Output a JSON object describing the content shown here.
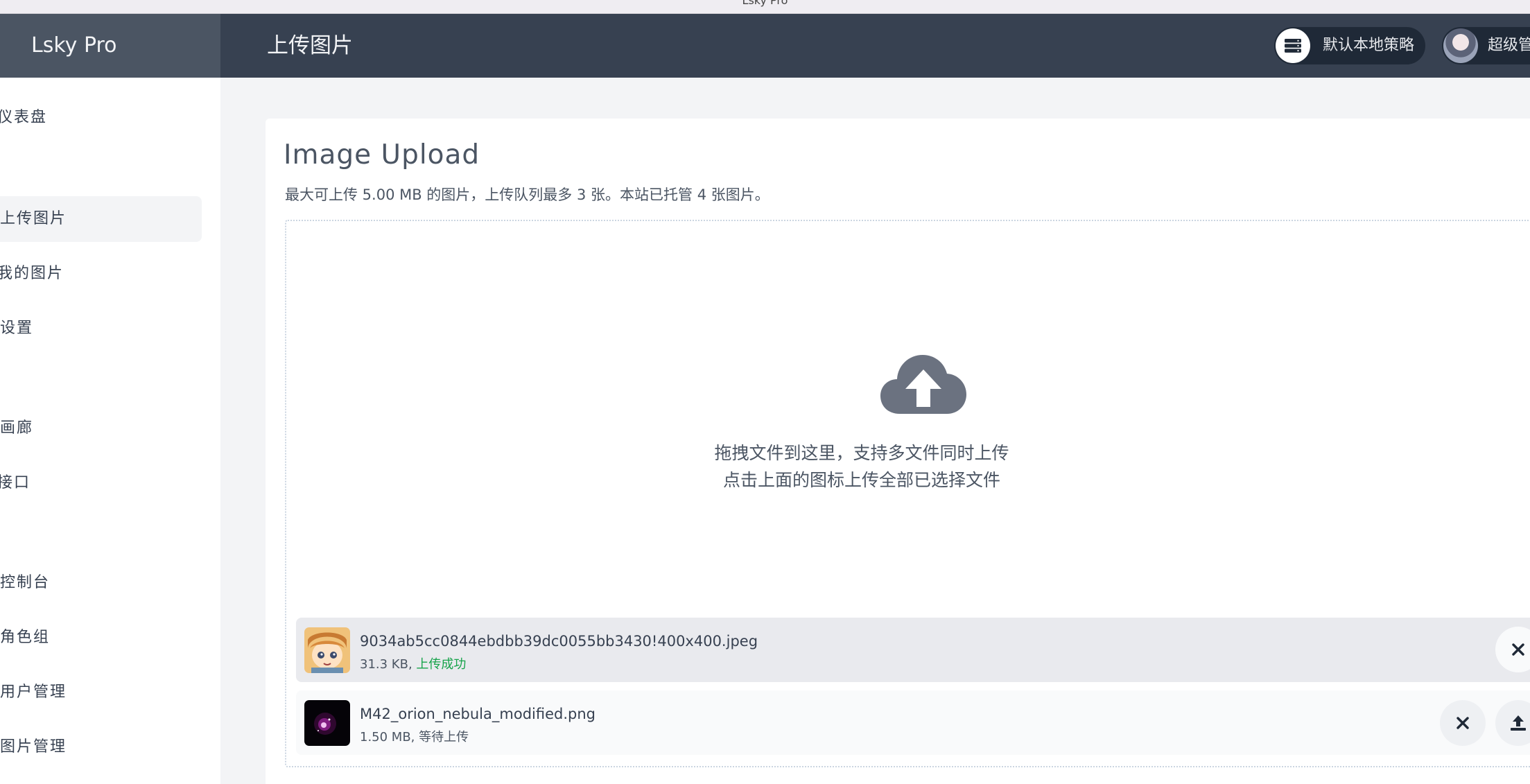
{
  "window": {
    "title": "Lsky Pro"
  },
  "brand": {
    "name": "Lsky Pro"
  },
  "header": {
    "page_title": "上传图片",
    "strategy_label": "默认本地策略",
    "user_label": "超级管"
  },
  "sidebar": {
    "items": [
      {
        "label": "仪表盘"
      },
      {
        "label": "上传图片",
        "active": true
      },
      {
        "label": "我的图片"
      },
      {
        "label": "设置"
      },
      {
        "label": "画廊"
      },
      {
        "label": "接口"
      },
      {
        "label": "控制台"
      },
      {
        "label": "角色组"
      },
      {
        "label": "用户管理"
      },
      {
        "label": "图片管理"
      }
    ]
  },
  "upload": {
    "title": "Image Upload",
    "subtitle": "最大可上传 5.00 MB 的图片，上传队列最多 3 张。本站已托管 4 张图片。",
    "drop_hint_line1": "拖拽文件到这里，支持多文件同时上传",
    "drop_hint_line2": "点击上面的图标上传全部已选择文件",
    "files": [
      {
        "name": "9034ab5cc0844ebdbb39dc0055bb3430!400x400.jpeg",
        "size": "31.3 KB, ",
        "status": "上传成功"
      },
      {
        "name": "M42_orion_nebula_modified.png",
        "size": "1.50 MB, ",
        "status": "等待上传"
      }
    ]
  },
  "colors": {
    "sidebar_header": "#4b5563",
    "topbar": "#374151",
    "success": "#16a34a"
  }
}
